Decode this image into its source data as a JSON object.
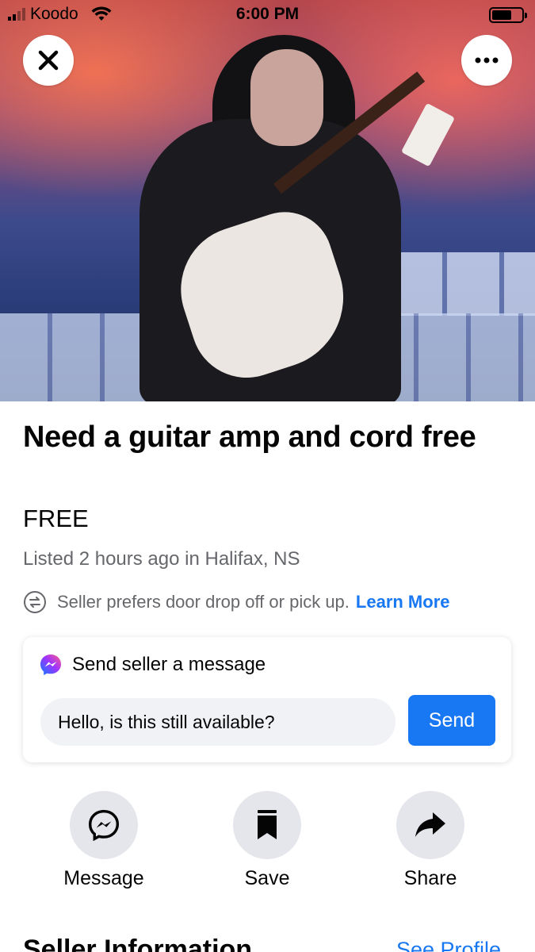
{
  "status_bar": {
    "carrier": "Koodo",
    "time": "6:00 PM"
  },
  "listing": {
    "title": "Need a guitar amp and cord free",
    "price": "FREE",
    "listed": "Listed 2 hours ago in Halifax, NS",
    "delivery_note": "Seller prefers door drop off or pick up.",
    "learn_more": "Learn More"
  },
  "message_card": {
    "header": "Send seller a message",
    "input_value": "Hello, is this still available?",
    "send_label": "Send"
  },
  "actions": [
    {
      "label": "Message",
      "icon": "messenger-icon"
    },
    {
      "label": "Save",
      "icon": "bookmark-icon"
    },
    {
      "label": "Share",
      "icon": "share-arrow-icon"
    }
  ],
  "seller_section": {
    "heading": "Seller Information",
    "see_profile": "See Profile"
  },
  "colors": {
    "accent": "#1877f2",
    "secondary_text": "#65676b",
    "action_circle": "#e4e6eb"
  }
}
